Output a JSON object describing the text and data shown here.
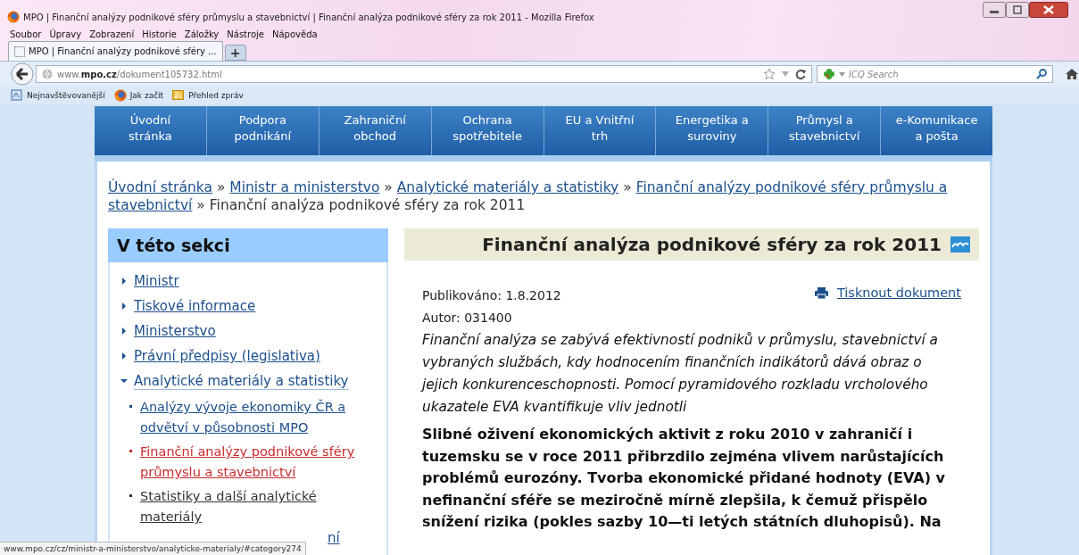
{
  "window": {
    "title": "MPO | Finanční analýzy podnikové sféry průmyslu a stavebnictví | Finanční analýza podnikové sféry za rok 2011 - Mozilla Firefox"
  },
  "menu": [
    "Soubor",
    "Úpravy",
    "Zobrazení",
    "Historie",
    "Záložky",
    "Nástroje",
    "Nápověda"
  ],
  "tabs": [
    {
      "label": "MPO | Finanční analýzy podnikové sféry ...",
      "selected": true
    }
  ],
  "new_tab": "+",
  "address_bar": {
    "url": "www.**mpo.cz**/dokument105732.html"
  },
  "search": {
    "placeholder": "ICQ Search"
  },
  "bookmarks": [
    {
      "label": "Nejnavštěvovanější",
      "kind": "places"
    },
    {
      "label": "Jak začít",
      "kind": "firefox"
    },
    {
      "label": "Přehled zpráv",
      "kind": "feed"
    }
  ],
  "site_nav": [
    "Úvodní stránka",
    "Podpora podnikání",
    "Zahraniční obchod",
    "Ochrana spotřebitele",
    "EU a Vnitřní trh",
    "Energetika a suroviny",
    "Průmysl a stavebnictví",
    "e-Komunikace a pošta"
  ],
  "breadcrumb": {
    "separator": "»",
    "links": [
      "Úvodní stránka",
      "Ministr a ministerstvo",
      "Analytické materiály a statistiky",
      "Finanční analýzy podnikové sféry průmyslu a stavebnictví"
    ],
    "current": "Finanční analýza podnikové sféry za rok 2011"
  },
  "sidebar": {
    "title": "V této sekci",
    "items": [
      {
        "label": "Ministr",
        "expanded": false
      },
      {
        "label": "Tiskové informace",
        "expanded": false
      },
      {
        "label": "Ministerstvo",
        "expanded": false
      },
      {
        "label": "Právní předpisy (legislativa)",
        "expanded": false
      },
      {
        "label": "Analytické materiály a statistiky",
        "expanded": true,
        "children": [
          {
            "label": "Analýzy vývoje ekonomiky ČR a odvětví v působnosti MPO",
            "selected": false,
            "visited": false
          },
          {
            "label": "Finanční analýzy podnikové sféry průmyslu a stavebnictví",
            "selected": true,
            "visited": false
          },
          {
            "label": "Statistiky a další analytické materiály",
            "selected": false,
            "visited": true
          }
        ]
      },
      {
        "label": "ní",
        "partial": true
      }
    ]
  },
  "article": {
    "title": "Finanční analýza podnikové sféry za rok 2011",
    "published": "Publikováno: 1.8.2012",
    "author": "Autor: 031400",
    "print_link": "Tisknout dokument",
    "perex": "Finanční analýza se zabývá efektivností podniků v průmyslu, stavebnictví a vybraných službách, kdy hodnocením finančních indikátorů dává obraz o jejich konkurenceschopnosti. Pomocí pyramidového rozkladu vrcholového ukazatele EVA kvantifikuje vliv jednotli",
    "lead": "Slibné oživení ekonomických aktivit z roku 2010 v zahraničí i tuzemsku se v roce 2011 přibrzdilo zejména vlivem narůstajících problémů eurozóny. Tvorba ekonomické přidané hodnoty (EVA) v nefinanční sféře se meziročně mírně zlepšila, k čemuž přispělo snížení rizika (pokles sazby 10—ti letých státních dluhopisů). Na"
  },
  "status_bar": "www.mpo.cz/cz/ministr-a-ministerstvo/analyticke-materialy/#category274"
}
